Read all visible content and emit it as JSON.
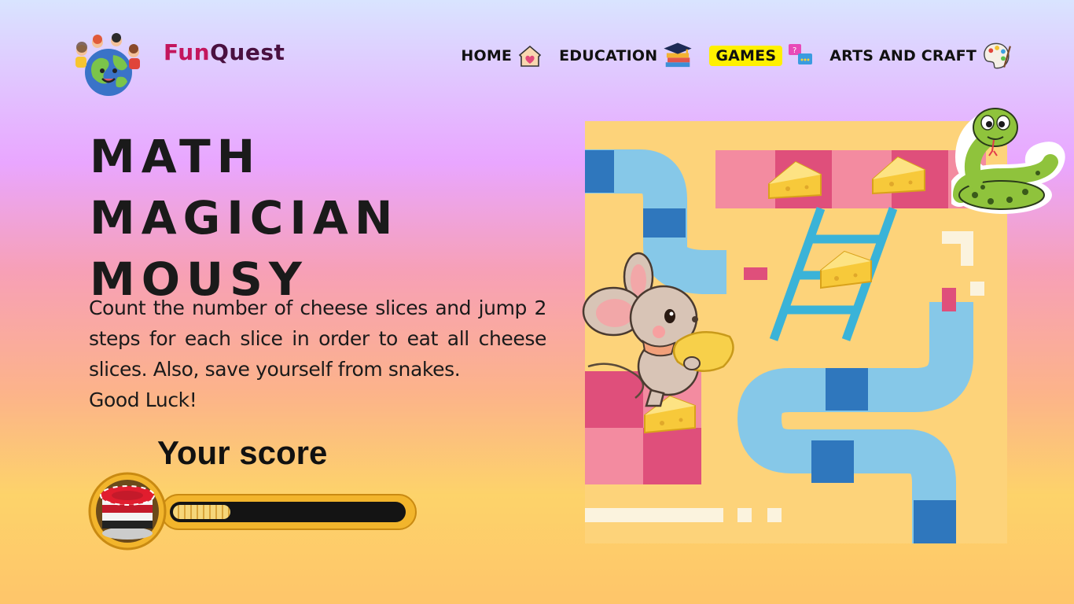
{
  "brand": {
    "name_part1": "Fun",
    "name_part2": "Quest",
    "logo_icon": "globe-kids-icon"
  },
  "nav": {
    "items": [
      {
        "label": "HOME",
        "icon": "house-heart-icon",
        "active": false
      },
      {
        "label": "EDUCATION",
        "icon": "graduation-books-icon",
        "active": false
      },
      {
        "label": "GAMES",
        "icon": "chat-bubbles-icon",
        "active": true
      },
      {
        "label": "ARTS AND CRAFT",
        "icon": "paint-palette-icon",
        "active": false
      }
    ],
    "active_color": "#fff000"
  },
  "game": {
    "title_line1": "MATH MAGICIAN",
    "title_line2": "MOUSY",
    "description": "Count the number of cheese slices and jump 2 steps for each slice in order to eat all cheese slices. Also, save yourself from snakes.",
    "good_luck": "Good Luck!",
    "score_label": "Your score",
    "score_progress": 0.25
  },
  "board": {
    "illustrations": [
      "snake-icon",
      "mouse-icon",
      "cheese-icon",
      "ladder-icon"
    ],
    "cheese_count": 4,
    "colors": {
      "background": "#fdd37a",
      "path": "#86c8e8",
      "path_dark": "#2f77bd",
      "pink": "#f38ba0",
      "pink_dark": "#df4f7b",
      "ladder": "#3ab3d8"
    }
  }
}
